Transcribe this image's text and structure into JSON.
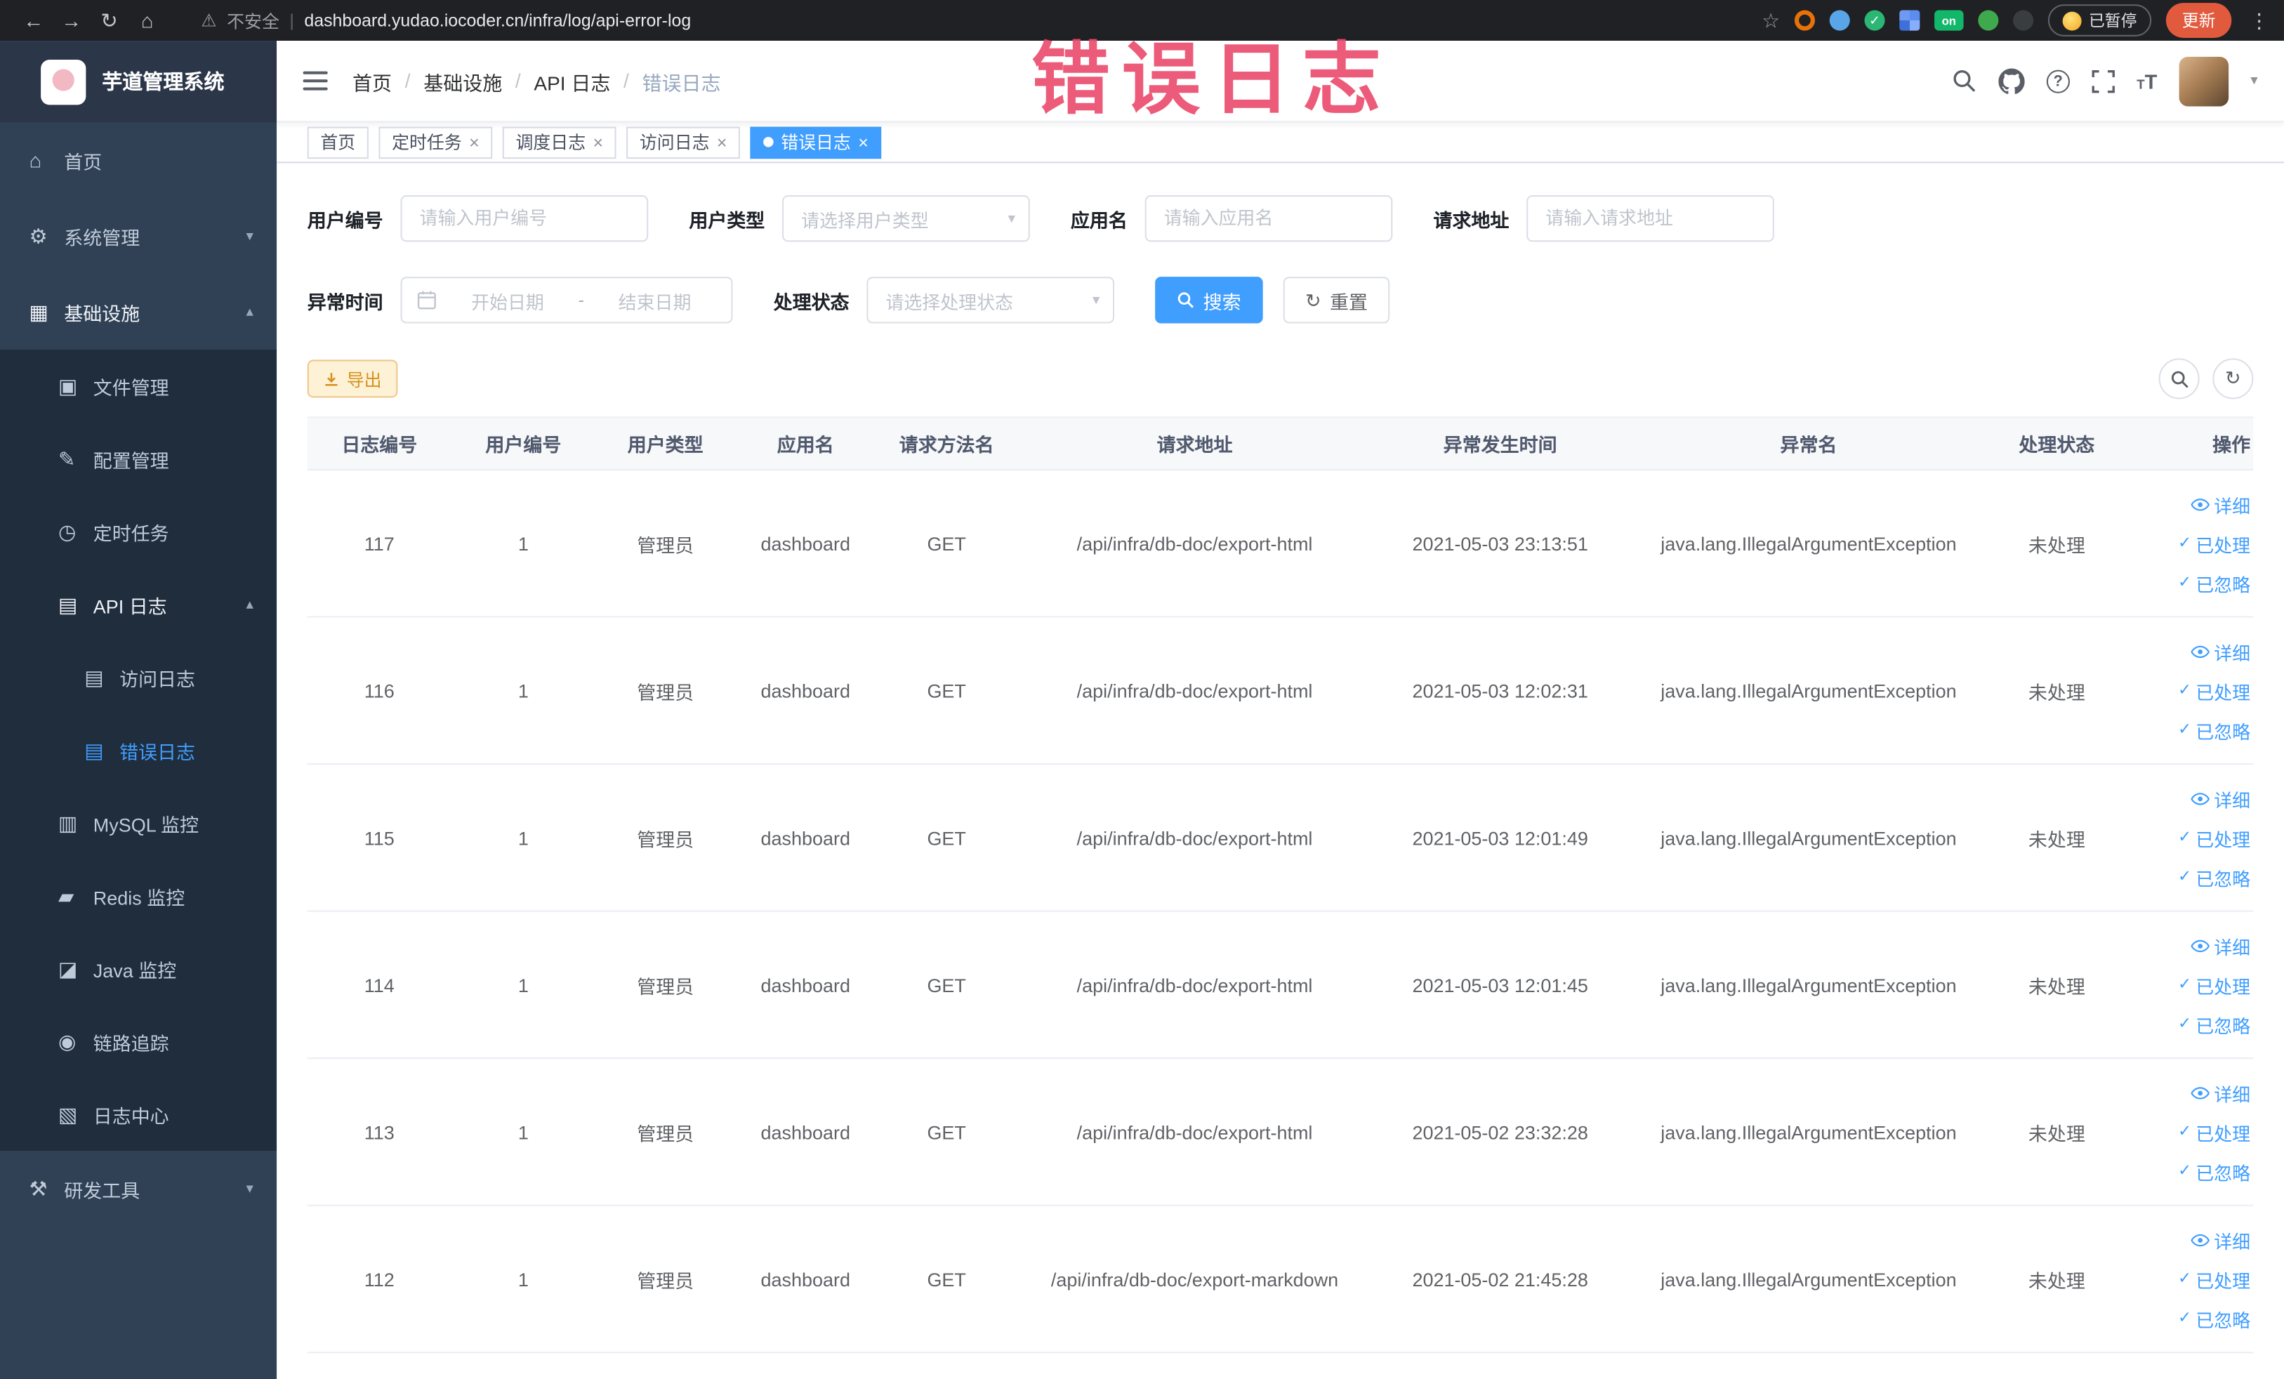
{
  "browser": {
    "security_label": "不安全",
    "url": "dashboard.yudao.iocoder.cn/infra/log/api-error-log",
    "paused_chip": "已暂停",
    "update_button": "更新",
    "ext_on_label": "on"
  },
  "annotation": {
    "overlay_text": "错误日志"
  },
  "icons": {
    "back": "←",
    "forward": "→",
    "reload": "↻",
    "home": "⌂",
    "warning": "⚠",
    "star": "☆",
    "menu_dots": "⋮",
    "chevron_down": "▾",
    "chevron_up": "▴",
    "caret_down": "▾",
    "close": "×",
    "check": "✓",
    "question": "?",
    "refresh": "↻",
    "separator": "|",
    "ext_check": "✓"
  },
  "sidebar": {
    "logo_title": "芋道管理系统",
    "items": [
      {
        "label": "首页",
        "glyph": "⌂"
      },
      {
        "label": "系统管理",
        "glyph": "⚙"
      },
      {
        "label": "基础设施",
        "glyph": "▦"
      },
      {
        "label": "文件管理",
        "glyph": "▣"
      },
      {
        "label": "配置管理",
        "glyph": "✎"
      },
      {
        "label": "定时任务",
        "glyph": "◷"
      },
      {
        "label": "API 日志",
        "glyph": "▤"
      },
      {
        "label": "访问日志",
        "glyph": "▤"
      },
      {
        "label": "错误日志",
        "glyph": "▤"
      },
      {
        "label": "MySQL 监控",
        "glyph": "▥"
      },
      {
        "label": "Redis 监控",
        "glyph": "▰"
      },
      {
        "label": "Java 监控",
        "glyph": "◪"
      },
      {
        "label": "链路追踪",
        "glyph": "◉"
      },
      {
        "label": "日志中心",
        "glyph": "▧"
      },
      {
        "label": "研发工具",
        "glyph": "⚒"
      }
    ]
  },
  "navbar": {
    "breadcrumb": [
      "首页",
      "基础设施",
      "API 日志",
      "错误日志"
    ]
  },
  "tabs": [
    {
      "label": "首页"
    },
    {
      "label": "定时任务"
    },
    {
      "label": "调度日志"
    },
    {
      "label": "访问日志"
    },
    {
      "label": "错误日志"
    }
  ],
  "filters": {
    "user_id_label": "用户编号",
    "user_id_placeholder": "请输入用户编号",
    "user_type_label": "用户类型",
    "user_type_placeholder": "请选择用户类型",
    "app_name_label": "应用名",
    "app_name_placeholder": "请输入应用名",
    "request_url_label": "请求地址",
    "request_url_placeholder": "请输入请求地址",
    "exception_time_label": "异常时间",
    "date_start_placeholder": "开始日期",
    "date_separator": "-",
    "date_end_placeholder": "结束日期",
    "process_status_label": "处理状态",
    "process_status_placeholder": "请选择处理状态",
    "search_button": "搜索",
    "reset_button": "重置"
  },
  "toolbar": {
    "export_button": "导出"
  },
  "table": {
    "columns": [
      "日志编号",
      "用户编号",
      "用户类型",
      "应用名",
      "请求方法名",
      "请求地址",
      "异常发生时间",
      "异常名",
      "处理状态",
      "操作"
    ],
    "actions": {
      "detail": "详细",
      "processed": "已处理",
      "ignored": "已忽略"
    },
    "rows": [
      {
        "log_id": "117",
        "user_id": "1",
        "user_type": "管理员",
        "app_name": "dashboard",
        "method": "GET",
        "url": "/api/infra/db-doc/export-html",
        "time": "2021-05-03 23:13:51",
        "exception": "java.lang.IllegalArgumentException",
        "status": "未处理"
      },
      {
        "log_id": "116",
        "user_id": "1",
        "user_type": "管理员",
        "app_name": "dashboard",
        "method": "GET",
        "url": "/api/infra/db-doc/export-html",
        "time": "2021-05-03 12:02:31",
        "exception": "java.lang.IllegalArgumentException",
        "status": "未处理"
      },
      {
        "log_id": "115",
        "user_id": "1",
        "user_type": "管理员",
        "app_name": "dashboard",
        "method": "GET",
        "url": "/api/infra/db-doc/export-html",
        "time": "2021-05-03 12:01:49",
        "exception": "java.lang.IllegalArgumentException",
        "status": "未处理"
      },
      {
        "log_id": "114",
        "user_id": "1",
        "user_type": "管理员",
        "app_name": "dashboard",
        "method": "GET",
        "url": "/api/infra/db-doc/export-html",
        "time": "2021-05-03 12:01:45",
        "exception": "java.lang.IllegalArgumentException",
        "status": "未处理"
      },
      {
        "log_id": "113",
        "user_id": "1",
        "user_type": "管理员",
        "app_name": "dashboard",
        "method": "GET",
        "url": "/api/infra/db-doc/export-html",
        "time": "2021-05-02 23:32:28",
        "exception": "java.lang.IllegalArgumentException",
        "status": "未处理"
      },
      {
        "log_id": "112",
        "user_id": "1",
        "user_type": "管理员",
        "app_name": "dashboard",
        "method": "GET",
        "url": "/api/infra/db-doc/export-markdown",
        "time": "2021-05-02 21:45:28",
        "exception": "java.lang.IllegalArgumentException",
        "status": "未处理"
      }
    ]
  }
}
